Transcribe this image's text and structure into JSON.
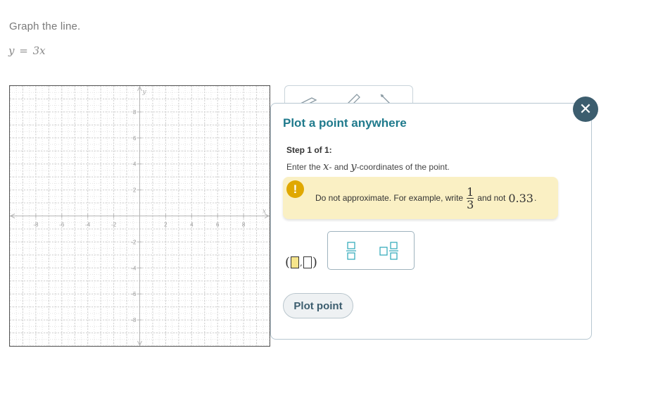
{
  "question": {
    "instruction": "Graph the line.",
    "equation": {
      "lhs": "y",
      "op": "=",
      "rhs": "3x"
    }
  },
  "graph": {
    "x_axis_label": "x",
    "y_axis_label": "y",
    "xlim": [
      -10,
      10
    ],
    "ylim": [
      -10,
      10
    ],
    "tick_labels": [
      -8,
      -6,
      -4,
      -2,
      2,
      4,
      6,
      8
    ]
  },
  "toolbar": {
    "tools": [
      "eraser-icon",
      "pencil-icon",
      "line-tool-icon"
    ]
  },
  "dialog": {
    "close_label": "✕",
    "title": "Plot a point anywhere",
    "step_label": "Step 1 of 1:",
    "step_text_prefix": "Enter the ",
    "step_var_x": "x",
    "step_text_mid": "- and ",
    "step_var_y": "y",
    "step_text_suffix": "-coordinates of the point.",
    "warning": {
      "icon": "!",
      "text_before": "Do not approximate. For example, write",
      "fraction_num": "1",
      "fraction_den": "3",
      "text_middle": "and not",
      "decimal": "0.33",
      "text_end": "."
    },
    "coordinate_input": {
      "open": "(",
      "sep": ",",
      "close": ")"
    },
    "keypad": {
      "keys": [
        "fraction-key",
        "mixed-number-key"
      ]
    },
    "plot_button_label": "Plot point"
  },
  "colors": {
    "accent": "#1f7a8c",
    "close_bg": "#3c5d6e",
    "warning_bg": "#faf0c4",
    "warning_icon": "#e0a800",
    "key_teal": "#2aa7b8"
  }
}
